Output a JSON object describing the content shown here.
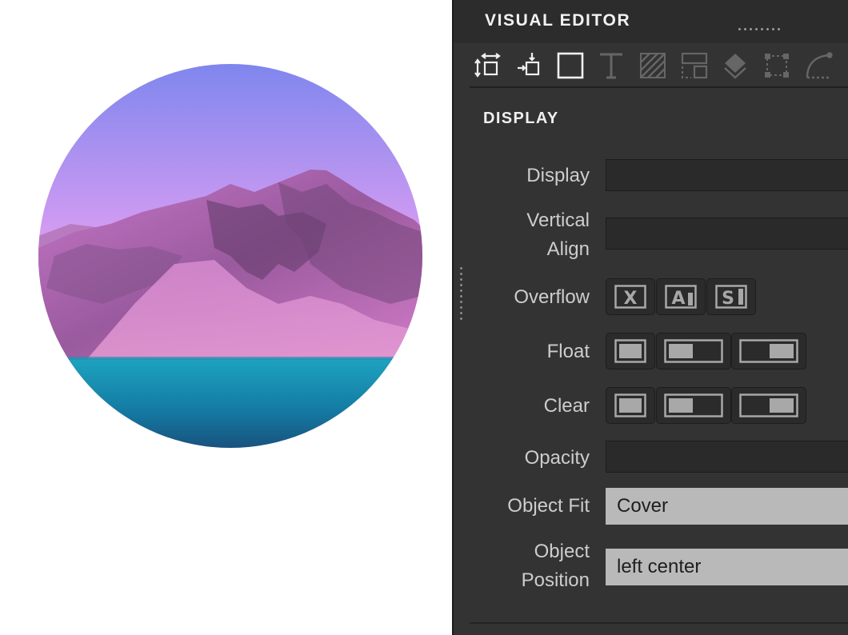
{
  "canvas": {
    "image_alt": "Circular landscape photo with pink mountains above a blue lake"
  },
  "panel": {
    "title": "VISUAL EDITOR",
    "toolbar": [
      "position-icon",
      "layout-icon",
      "box-icon",
      "typography-icon",
      "background-icon",
      "border-icon",
      "effects-icon",
      "transform-icon",
      "transition-icon"
    ],
    "section": "DISPLAY",
    "fields": {
      "display": {
        "label": "Display",
        "value": ""
      },
      "vertical_align": {
        "label_1": "Vertical",
        "label_2": "Align",
        "value": ""
      },
      "overflow": {
        "label": "Overflow",
        "options": [
          "X",
          "A",
          "S"
        ]
      },
      "float": {
        "label": "Float"
      },
      "clear": {
        "label": "Clear"
      },
      "opacity": {
        "label": "Opacity",
        "value": ""
      },
      "object_fit": {
        "label": "Object Fit",
        "value": "Cover"
      },
      "object_position": {
        "label_1": "Object",
        "label_2": "Position",
        "value": "left center"
      }
    }
  },
  "colors": {
    "panel_bg": "#333333",
    "header_bg": "#2c2c2c",
    "field_bg": "#2a2a2a",
    "input_light": "#b9b9b9"
  }
}
